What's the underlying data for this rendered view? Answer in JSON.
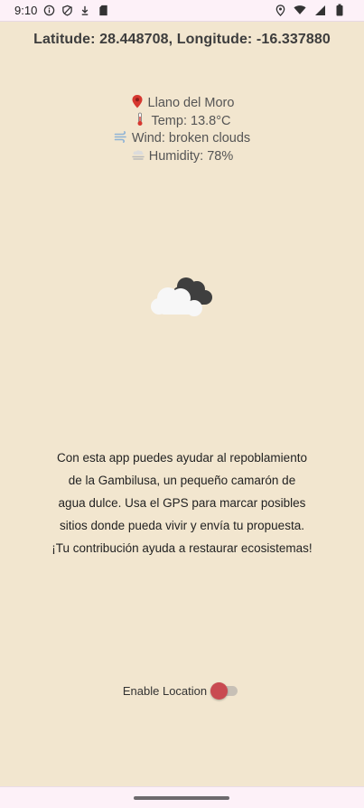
{
  "status_bar": {
    "time": "9:10",
    "icons_left": [
      "info-icon",
      "shield-icon",
      "download-icon",
      "sd-card-icon"
    ],
    "icons_right": [
      "location-icon",
      "wifi-icon",
      "signal-icon",
      "battery-icon"
    ]
  },
  "header": {
    "coords": "Latitude: 28.448708, Longitude: -16.337880"
  },
  "weather": {
    "location": "Llano del Moro",
    "temp": "Temp: 13.8°C",
    "wind": "Wind: broken clouds",
    "humidity": "Humidity: 78%",
    "icon": "broken-clouds-icon"
  },
  "description": {
    "text": "Con esta app puedes ayudar al repoblamiento\nde la Gambilusa, un pequeño camarón de\nagua dulce. Usa el GPS para marcar posibles\nsitios donde pueda vivir y envía tu propuesta.\n¡Tu contribución ayuda a restaurar ecosistemas!"
  },
  "location_toggle": {
    "label": "Enable Location",
    "enabled": false
  },
  "colors": {
    "background": "#f2e6cf",
    "toggle_thumb": "#c94a51",
    "system_bars": "#fdf1f8"
  }
}
